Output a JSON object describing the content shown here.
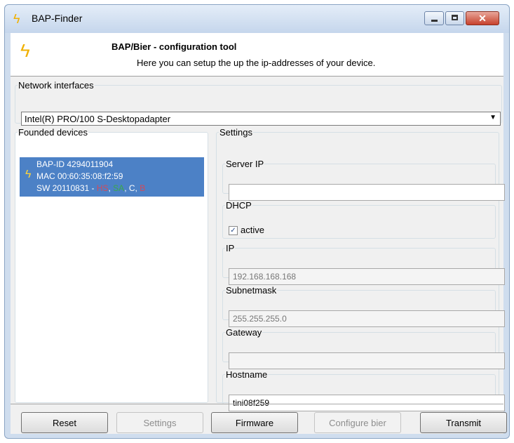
{
  "window": {
    "title": "BAP-Finder",
    "close_glyph": "✕"
  },
  "header": {
    "title": "BAP/Bier - configuration tool",
    "subtitle": "Here you can setup the up the ip-addresses of your device."
  },
  "network": {
    "legend": "Network interfaces",
    "selected": "Intel(R) PRO/100 S-Desktopadapter",
    "arrow": "▼"
  },
  "devices": {
    "legend": "Founded devices",
    "items": [
      {
        "line1": "BAP-ID 4294011904",
        "line2": "MAC 00:60:35:08:f2:59",
        "sw_prefix": "SW 20110831 - ",
        "tag_hs": "HS",
        "tag_sa": "SA",
        "tag_c": "C",
        "tag_b": "B",
        "sep": ", "
      }
    ]
  },
  "settings": {
    "legend": "Settings",
    "server_ip": {
      "legend": "Server IP",
      "value": ""
    },
    "dhcp": {
      "legend": "DHCP",
      "checkbox_label": "active",
      "checked": "✓"
    },
    "ip": {
      "legend": "IP",
      "value": "192.168.168.168"
    },
    "subnetmask": {
      "legend": "Subnetmask",
      "value": "255.255.255.0"
    },
    "gateway": {
      "legend": "Gateway",
      "value": ""
    },
    "hostname": {
      "legend": "Hostname",
      "value": "tini08f259"
    }
  },
  "buttons": {
    "reset": "Reset",
    "settings": "Settings",
    "firmware": "Firmware",
    "configure_bier": "Configure bier",
    "transmit": "Transmit"
  },
  "icons": {
    "app": "lightning-icon",
    "color": "#f0b000"
  }
}
